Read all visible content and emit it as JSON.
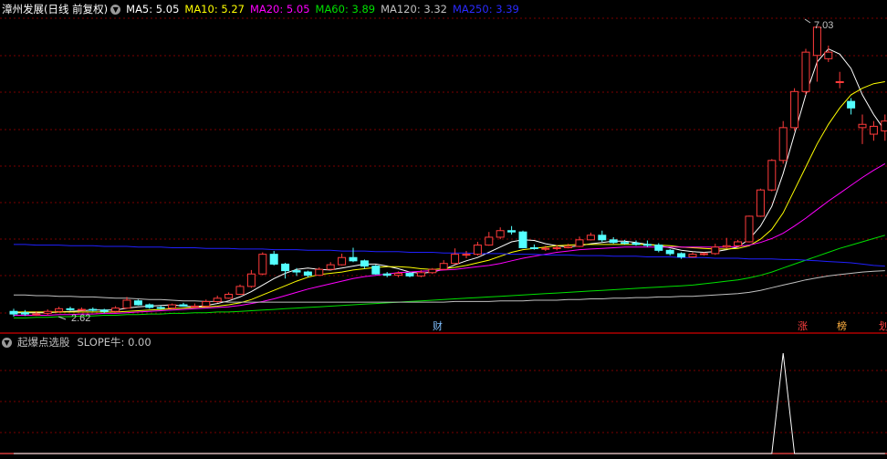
{
  "header": {
    "title": "漳州发展(日线 前复权)",
    "ma_indicators": [
      {
        "label": "MA5: 5.05",
        "color": "#ffffff"
      },
      {
        "label": "MA10: 5.27",
        "color": "#ffff00"
      },
      {
        "label": "MA20: 5.05",
        "color": "#ff00ff"
      },
      {
        "label": "MA60: 3.89",
        "color": "#00e000"
      },
      {
        "label": "MA120: 3.32",
        "color": "#c0c0c0"
      },
      {
        "label": "MA250: 3.39",
        "color": "#2020ff"
      }
    ]
  },
  "price_labels": {
    "high": "7.03",
    "low": "2.62"
  },
  "markers": {
    "cai": "财",
    "zhang": "涨",
    "bang": "榜",
    "edge": "划"
  },
  "sub": {
    "title": "起爆点选股",
    "slope_label": "SLOPE牛: 0.00"
  },
  "colors": {
    "up": "#ff3b3b",
    "down": "#54ffff",
    "grid": "#7a0000",
    "border": "#b00000"
  },
  "chart_data": {
    "type": "candlestick",
    "candles": [
      [
        2.7,
        2.66,
        2.74,
        2.62
      ],
      [
        2.68,
        2.66,
        2.72,
        2.63
      ],
      [
        2.66,
        2.66,
        2.7,
        2.63
      ],
      [
        2.67,
        2.7,
        2.73,
        2.64
      ],
      [
        2.7,
        2.74,
        2.77,
        2.68
      ],
      [
        2.74,
        2.73,
        2.77,
        2.71
      ],
      [
        2.73,
        2.73,
        2.76,
        2.71
      ],
      [
        2.73,
        2.72,
        2.76,
        2.7
      ],
      [
        2.72,
        2.7,
        2.74,
        2.67
      ],
      [
        2.7,
        2.75,
        2.78,
        2.68
      ],
      [
        2.75,
        2.87,
        2.92,
        2.74
      ],
      [
        2.86,
        2.8,
        2.88,
        2.79
      ],
      [
        2.8,
        2.76,
        2.82,
        2.74
      ],
      [
        2.76,
        2.75,
        2.79,
        2.73
      ],
      [
        2.75,
        2.8,
        2.82,
        2.74
      ],
      [
        2.8,
        2.78,
        2.83,
        2.77
      ],
      [
        2.78,
        2.78,
        2.82,
        2.76
      ],
      [
        2.78,
        2.85,
        2.88,
        2.77
      ],
      [
        2.85,
        2.9,
        2.94,
        2.83
      ],
      [
        2.9,
        2.96,
        2.99,
        2.89
      ],
      [
        2.96,
        3.08,
        3.11,
        2.95
      ],
      [
        3.08,
        3.27,
        3.33,
        3.06
      ],
      [
        3.27,
        3.57,
        3.6,
        3.25
      ],
      [
        3.57,
        3.42,
        3.62,
        3.4
      ],
      [
        3.42,
        3.32,
        3.44,
        3.2
      ],
      [
        3.32,
        3.3,
        3.36,
        3.24
      ],
      [
        3.3,
        3.25,
        3.32,
        3.22
      ],
      [
        3.25,
        3.34,
        3.37,
        3.24
      ],
      [
        3.34,
        3.41,
        3.45,
        3.33
      ],
      [
        3.41,
        3.52,
        3.58,
        3.4
      ],
      [
        3.52,
        3.47,
        3.67,
        3.45
      ],
      [
        3.47,
        3.39,
        3.49,
        3.35
      ],
      [
        3.39,
        3.27,
        3.41,
        3.26
      ],
      [
        3.27,
        3.25,
        3.3,
        3.22
      ],
      [
        3.25,
        3.28,
        3.31,
        3.22
      ],
      [
        3.28,
        3.24,
        3.3,
        3.22
      ],
      [
        3.24,
        3.29,
        3.33,
        3.22
      ],
      [
        3.29,
        3.34,
        3.36,
        3.27
      ],
      [
        3.34,
        3.43,
        3.48,
        3.33
      ],
      [
        3.43,
        3.57,
        3.66,
        3.42
      ],
      [
        3.57,
        3.57,
        3.62,
        3.51
      ],
      [
        3.57,
        3.71,
        3.76,
        3.55
      ],
      [
        3.71,
        3.83,
        3.91,
        3.7
      ],
      [
        3.83,
        3.93,
        3.98,
        3.8
      ],
      [
        3.93,
        3.91,
        4.0,
        3.87
      ],
      [
        3.91,
        3.67,
        3.93,
        3.66
      ],
      [
        3.67,
        3.66,
        3.72,
        3.64
      ],
      [
        3.66,
        3.66,
        3.7,
        3.62
      ],
      [
        3.66,
        3.67,
        3.71,
        3.63
      ],
      [
        3.67,
        3.69,
        3.73,
        3.66
      ],
      [
        3.69,
        3.79,
        3.84,
        3.68
      ],
      [
        3.79,
        3.86,
        3.9,
        3.78
      ],
      [
        3.86,
        3.79,
        3.93,
        3.76
      ],
      [
        3.79,
        3.75,
        3.83,
        3.73
      ],
      [
        3.75,
        3.74,
        3.79,
        3.72
      ],
      [
        3.74,
        3.72,
        3.78,
        3.7
      ],
      [
        3.72,
        3.71,
        3.78,
        3.68
      ],
      [
        3.71,
        3.63,
        3.74,
        3.6
      ],
      [
        3.63,
        3.58,
        3.65,
        3.55
      ],
      [
        3.58,
        3.53,
        3.6,
        3.5
      ],
      [
        3.53,
        3.57,
        3.6,
        3.52
      ],
      [
        3.57,
        3.58,
        3.6,
        3.55
      ],
      [
        3.58,
        3.68,
        3.73,
        3.56
      ],
      [
        3.68,
        3.7,
        3.82,
        3.66
      ],
      [
        3.7,
        3.76,
        3.79,
        3.68
      ],
      [
        3.76,
        4.15,
        4.16,
        3.75
      ],
      [
        4.15,
        4.55,
        4.57,
        4.14
      ],
      [
        4.55,
        5.0,
        5.02,
        4.53
      ],
      [
        5.0,
        5.5,
        5.6,
        4.95
      ],
      [
        5.5,
        6.05,
        6.1,
        5.45
      ],
      [
        6.05,
        6.65,
        6.7,
        6.0
      ],
      [
        6.6,
        7.03,
        7.03,
        6.2
      ],
      [
        6.55,
        6.65,
        6.75,
        6.5
      ],
      [
        6.2,
        6.2,
        6.35,
        6.1
      ],
      [
        5.9,
        5.8,
        5.95,
        5.7
      ],
      [
        5.5,
        5.55,
        5.7,
        5.25
      ],
      [
        5.4,
        5.52,
        5.6,
        5.3
      ],
      [
        5.45,
        5.6,
        5.7,
        5.3
      ]
    ],
    "ma_series": [
      {
        "name": "MA5",
        "values": [
          2.68,
          2.68,
          2.68,
          2.68,
          2.69,
          2.7,
          2.71,
          2.72,
          2.72,
          2.72,
          2.75,
          2.77,
          2.78,
          2.79,
          2.8,
          2.78,
          2.77,
          2.79,
          2.82,
          2.86,
          2.92,
          3.0,
          3.1,
          3.2,
          3.28,
          3.34,
          3.36,
          3.34,
          3.33,
          3.36,
          3.39,
          3.42,
          3.42,
          3.39,
          3.35,
          3.3,
          3.28,
          3.3,
          3.34,
          3.41,
          3.47,
          3.52,
          3.6,
          3.68,
          3.76,
          3.79,
          3.78,
          3.73,
          3.7,
          3.68,
          3.7,
          3.73,
          3.75,
          3.77,
          3.77,
          3.75,
          3.72,
          3.7,
          3.67,
          3.63,
          3.61,
          3.6,
          3.61,
          3.64,
          3.68,
          3.8,
          4.0,
          4.3,
          4.8,
          5.4,
          6.0,
          6.5,
          6.7,
          6.62,
          6.4,
          6.0,
          5.7,
          5.45
        ]
      },
      {
        "name": "MA10",
        "values": [
          2.69,
          2.69,
          2.69,
          2.69,
          2.69,
          2.69,
          2.69,
          2.69,
          2.69,
          2.69,
          2.7,
          2.71,
          2.72,
          2.73,
          2.74,
          2.75,
          2.76,
          2.77,
          2.78,
          2.8,
          2.83,
          2.88,
          2.95,
          3.02,
          3.09,
          3.16,
          3.22,
          3.26,
          3.28,
          3.3,
          3.33,
          3.35,
          3.37,
          3.38,
          3.38,
          3.37,
          3.35,
          3.34,
          3.35,
          3.37,
          3.4,
          3.44,
          3.48,
          3.54,
          3.6,
          3.64,
          3.66,
          3.68,
          3.7,
          3.71,
          3.72,
          3.72,
          3.72,
          3.72,
          3.72,
          3.72,
          3.72,
          3.71,
          3.7,
          3.68,
          3.67,
          3.66,
          3.65,
          3.65,
          3.66,
          3.7,
          3.8,
          3.95,
          4.2,
          4.55,
          4.9,
          5.25,
          5.55,
          5.8,
          6.0,
          6.1,
          6.17,
          6.2
        ]
      },
      {
        "name": "MA20",
        "values": [
          2.64,
          2.64,
          2.64,
          2.64,
          2.65,
          2.65,
          2.66,
          2.66,
          2.67,
          2.67,
          2.68,
          2.69,
          2.7,
          2.71,
          2.72,
          2.73,
          2.74,
          2.75,
          2.76,
          2.77,
          2.79,
          2.82,
          2.85,
          2.89,
          2.94,
          2.99,
          3.04,
          3.08,
          3.12,
          3.16,
          3.2,
          3.23,
          3.25,
          3.27,
          3.29,
          3.3,
          3.31,
          3.32,
          3.33,
          3.34,
          3.36,
          3.38,
          3.4,
          3.43,
          3.47,
          3.51,
          3.54,
          3.57,
          3.6,
          3.62,
          3.64,
          3.65,
          3.66,
          3.67,
          3.68,
          3.68,
          3.68,
          3.68,
          3.68,
          3.68,
          3.68,
          3.68,
          3.68,
          3.68,
          3.69,
          3.71,
          3.75,
          3.81,
          3.89,
          4.0,
          4.12,
          4.25,
          4.38,
          4.5,
          4.62,
          4.74,
          4.85,
          4.95
        ]
      },
      {
        "name": "MA60",
        "values": [
          2.6,
          2.6,
          2.61,
          2.61,
          2.62,
          2.62,
          2.63,
          2.63,
          2.64,
          2.64,
          2.65,
          2.65,
          2.66,
          2.66,
          2.67,
          2.67,
          2.68,
          2.68,
          2.69,
          2.69,
          2.7,
          2.71,
          2.72,
          2.73,
          2.74,
          2.75,
          2.76,
          2.77,
          2.78,
          2.79,
          2.8,
          2.81,
          2.82,
          2.83,
          2.84,
          2.85,
          2.86,
          2.87,
          2.88,
          2.89,
          2.9,
          2.91,
          2.92,
          2.93,
          2.94,
          2.95,
          2.96,
          2.97,
          2.98,
          2.99,
          3.0,
          3.01,
          3.02,
          3.03,
          3.04,
          3.05,
          3.06,
          3.07,
          3.08,
          3.09,
          3.1,
          3.12,
          3.14,
          3.16,
          3.18,
          3.21,
          3.25,
          3.3,
          3.36,
          3.42,
          3.48,
          3.54,
          3.6,
          3.66,
          3.71,
          3.76,
          3.81,
          3.86
        ]
      },
      {
        "name": "MA120",
        "values": [
          2.95,
          2.95,
          2.94,
          2.94,
          2.93,
          2.93,
          2.92,
          2.92,
          2.91,
          2.9,
          2.9,
          2.89,
          2.88,
          2.88,
          2.87,
          2.86,
          2.86,
          2.85,
          2.85,
          2.84,
          2.84,
          2.84,
          2.84,
          2.84,
          2.84,
          2.84,
          2.84,
          2.84,
          2.84,
          2.84,
          2.84,
          2.84,
          2.84,
          2.84,
          2.84,
          2.84,
          2.84,
          2.84,
          2.84,
          2.85,
          2.85,
          2.85,
          2.85,
          2.86,
          2.86,
          2.86,
          2.87,
          2.87,
          2.87,
          2.88,
          2.88,
          2.89,
          2.89,
          2.9,
          2.9,
          2.91,
          2.91,
          2.92,
          2.92,
          2.93,
          2.93,
          2.94,
          2.95,
          2.96,
          2.97,
          2.99,
          3.02,
          3.06,
          3.1,
          3.14,
          3.18,
          3.21,
          3.24,
          3.26,
          3.28,
          3.3,
          3.31,
          3.32
        ]
      },
      {
        "name": "MA250",
        "values": [
          3.72,
          3.72,
          3.71,
          3.71,
          3.71,
          3.7,
          3.7,
          3.7,
          3.69,
          3.69,
          3.69,
          3.68,
          3.68,
          3.68,
          3.67,
          3.67,
          3.67,
          3.66,
          3.66,
          3.66,
          3.65,
          3.65,
          3.65,
          3.64,
          3.64,
          3.64,
          3.63,
          3.63,
          3.63,
          3.62,
          3.62,
          3.62,
          3.61,
          3.61,
          3.61,
          3.6,
          3.6,
          3.6,
          3.59,
          3.59,
          3.59,
          3.58,
          3.58,
          3.58,
          3.57,
          3.57,
          3.57,
          3.56,
          3.56,
          3.56,
          3.55,
          3.55,
          3.55,
          3.54,
          3.54,
          3.54,
          3.53,
          3.53,
          3.53,
          3.52,
          3.52,
          3.52,
          3.51,
          3.51,
          3.51,
          3.5,
          3.5,
          3.5,
          3.49,
          3.49,
          3.48,
          3.47,
          3.46,
          3.45,
          3.44,
          3.42,
          3.4,
          3.39
        ]
      }
    ],
    "signal": [
      0,
      0,
      0,
      0,
      0,
      0,
      0,
      0,
      0,
      0,
      0,
      0,
      0,
      0,
      0,
      0,
      0,
      0,
      0,
      0,
      0,
      0,
      0,
      0,
      0,
      0,
      0,
      0,
      0,
      0,
      0,
      0,
      0,
      0,
      0,
      0,
      0,
      0,
      0,
      0,
      0,
      0,
      0,
      0,
      0,
      0,
      0,
      0,
      0,
      0,
      0,
      0,
      0,
      0,
      0,
      0,
      0,
      0,
      0,
      0,
      0,
      0,
      0,
      0,
      0,
      0,
      0,
      0,
      1,
      0,
      0,
      0,
      0,
      0,
      0,
      0,
      0,
      0
    ],
    "price_range": [
      2.55,
      7.25
    ],
    "grid": true
  }
}
